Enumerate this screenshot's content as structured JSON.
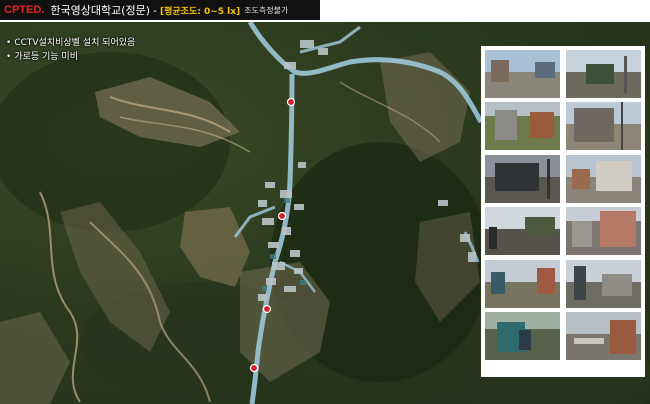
{
  "header": {
    "brand": "CPTED.",
    "place": "한국영상대학교(정문)",
    "separator": "-",
    "illuminance": "[평균조도: 0~5 lx]",
    "note": "조도측정불가"
  },
  "findings": [
    "CCTV설치비상벨 설치 되어있음",
    "가로등 기능 미비"
  ],
  "photos": [
    {
      "label": "street-view-1"
    },
    {
      "label": "street-view-2"
    },
    {
      "label": "street-view-3"
    },
    {
      "label": "street-view-4"
    },
    {
      "label": "street-view-5"
    },
    {
      "label": "street-view-6"
    },
    {
      "label": "street-view-7"
    },
    {
      "label": "street-view-8"
    },
    {
      "label": "street-view-9"
    },
    {
      "label": "street-view-10"
    },
    {
      "label": "street-view-11"
    },
    {
      "label": "street-view-12"
    }
  ],
  "colors": {
    "brand": "#e2231a",
    "illuminance": "#f2c200",
    "route": "#9cc6d8",
    "marker": "#d21f2a"
  }
}
